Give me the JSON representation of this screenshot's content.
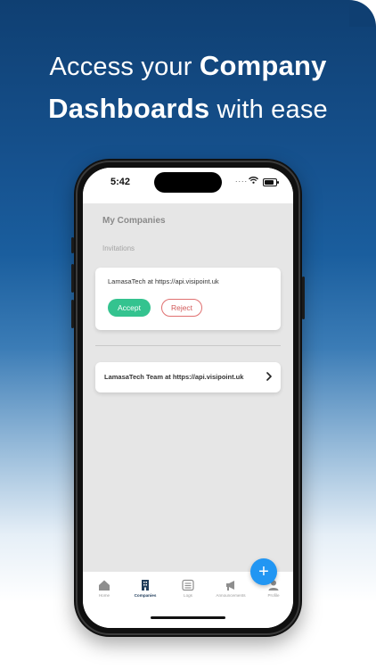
{
  "promo": {
    "line1_pre": "Access your",
    "line1_bold": "Company",
    "line2_bold": "Dashboards",
    "line2_post": "with ease"
  },
  "status_bar": {
    "time": "5:42"
  },
  "screen": {
    "title": "My Companies",
    "invitations_heading": "Invitations",
    "invitation": {
      "text": "LamasaTech at https://api.visipoint.uk",
      "accept_label": "Accept",
      "reject_label": "Reject"
    },
    "company": {
      "text": "LamasaTech Team at https://api.visipoint.uk"
    },
    "fab_icon": "plus-icon"
  },
  "tabs": [
    {
      "label": "Home",
      "icon": "home-icon",
      "active": false
    },
    {
      "label": "Companies",
      "icon": "building-icon",
      "active": true
    },
    {
      "label": "Logs",
      "icon": "list-icon",
      "active": false
    },
    {
      "label": "Announcements",
      "icon": "megaphone-icon",
      "active": false
    },
    {
      "label": "Profile",
      "icon": "person-icon",
      "active": false
    }
  ],
  "colors": {
    "accept": "#34c38f",
    "reject": "#d25a5a",
    "fab": "#2196f3",
    "active_tab": "#1f3c5a"
  }
}
